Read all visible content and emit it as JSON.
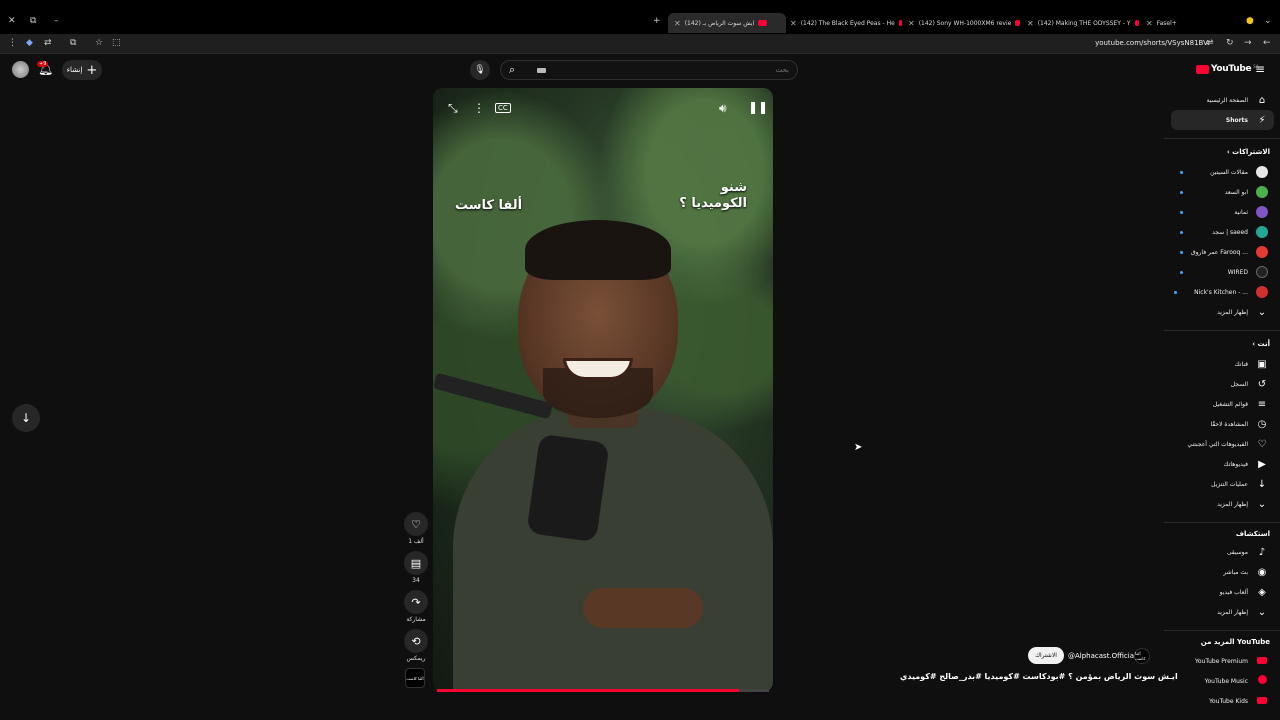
{
  "browser": {
    "tabs": [
      {
        "label": "(142) ايش سوت الرياض بـ",
        "active": true
      },
      {
        "label": "(142) The Black Eyed Peas - He"
      },
      {
        "label": "(142) Sony WH-1000XM6 revie"
      },
      {
        "label": "(142) Making THE ODYSSEY - Y"
      },
      {
        "label": "Fasel+"
      }
    ],
    "url": "youtube.com/shorts/VSysN81BVI"
  },
  "topbar": {
    "create_label": "إنشاء",
    "notifications_badge": "+9",
    "search_placeholder": "بحث",
    "logo_text": "YouTube",
    "logo_region": "SA"
  },
  "video": {
    "caption_left": "ألفا كاست",
    "caption_right": "شنو\nالكوميديا ؟",
    "progress": 0.91
  },
  "actions": {
    "likes": "1 ألف",
    "comments": "34",
    "share": "مشاركة",
    "remix": "ريمكس",
    "channel_thumb_text": "ألفا كاست"
  },
  "meta": {
    "subscribe_label": "الاشتراك",
    "channel_name": "@Alphacast.Official",
    "channel_avatar_text": "ألفا كاست",
    "title": "ايـش سوت الرياض بمؤمن ؟ #بودكاست #كوميديا #بدر_صالح #كوميدي"
  },
  "sidebar": {
    "main": [
      {
        "label": "الصفحة الرئيسية",
        "icon": "home-icon",
        "glyph": "⌂"
      },
      {
        "label": "Shorts",
        "icon": "shorts-icon",
        "glyph": "⚡",
        "active": true
      }
    ],
    "subscriptions_title": "الاشتراكات",
    "subscriptions": [
      {
        "label": "مقالات السيتين",
        "color": "#e8e8e8"
      },
      {
        "label": "ابو السعد",
        "color": "#4caf50"
      },
      {
        "label": "ثمانية",
        "color": "#7e57c2"
      },
      {
        "label": "سجد | saeed",
        "color": "#26a69a"
      },
      {
        "label": "عمر فاروق Farooq ...",
        "color": "#e53935"
      },
      {
        "label": "WIRED",
        "color": "#222222"
      },
      {
        "label": "Nick's Kitchen - ...",
        "color": "#d32f2f"
      }
    ],
    "show_more": "إظهار المزيد",
    "you_title": "أنت",
    "you": [
      {
        "label": "قناتك",
        "icon": "channel-icon",
        "glyph": "▣"
      },
      {
        "label": "السجل",
        "icon": "history-icon",
        "glyph": "↺"
      },
      {
        "label": "قوائم التشغيل",
        "icon": "playlists-icon",
        "glyph": "≡"
      },
      {
        "label": "المشاهدة لاحقًا",
        "icon": "watch-later-icon",
        "glyph": "◷"
      },
      {
        "label": "الفيديوهات التي أعجبتني",
        "icon": "liked-icon",
        "glyph": "♡"
      },
      {
        "label": "فيديوهاتك",
        "icon": "your-videos-icon",
        "glyph": "▶"
      },
      {
        "label": "عمليات التنزيل",
        "icon": "download-icon",
        "glyph": "↓"
      }
    ],
    "explore_title": "استكشاف",
    "explore": [
      {
        "label": "موسيقى",
        "icon": "music-icon",
        "glyph": "♪"
      },
      {
        "label": "بث مباشر",
        "icon": "live-icon",
        "glyph": "◉"
      },
      {
        "label": "ألعاب فيديو",
        "icon": "gaming-icon",
        "glyph": "◈"
      }
    ],
    "more_title": "المزيد من YouTube",
    "more": [
      {
        "label": "YouTube Premium"
      },
      {
        "label": "YouTube Music"
      },
      {
        "label": "YouTube Kids"
      }
    ]
  }
}
